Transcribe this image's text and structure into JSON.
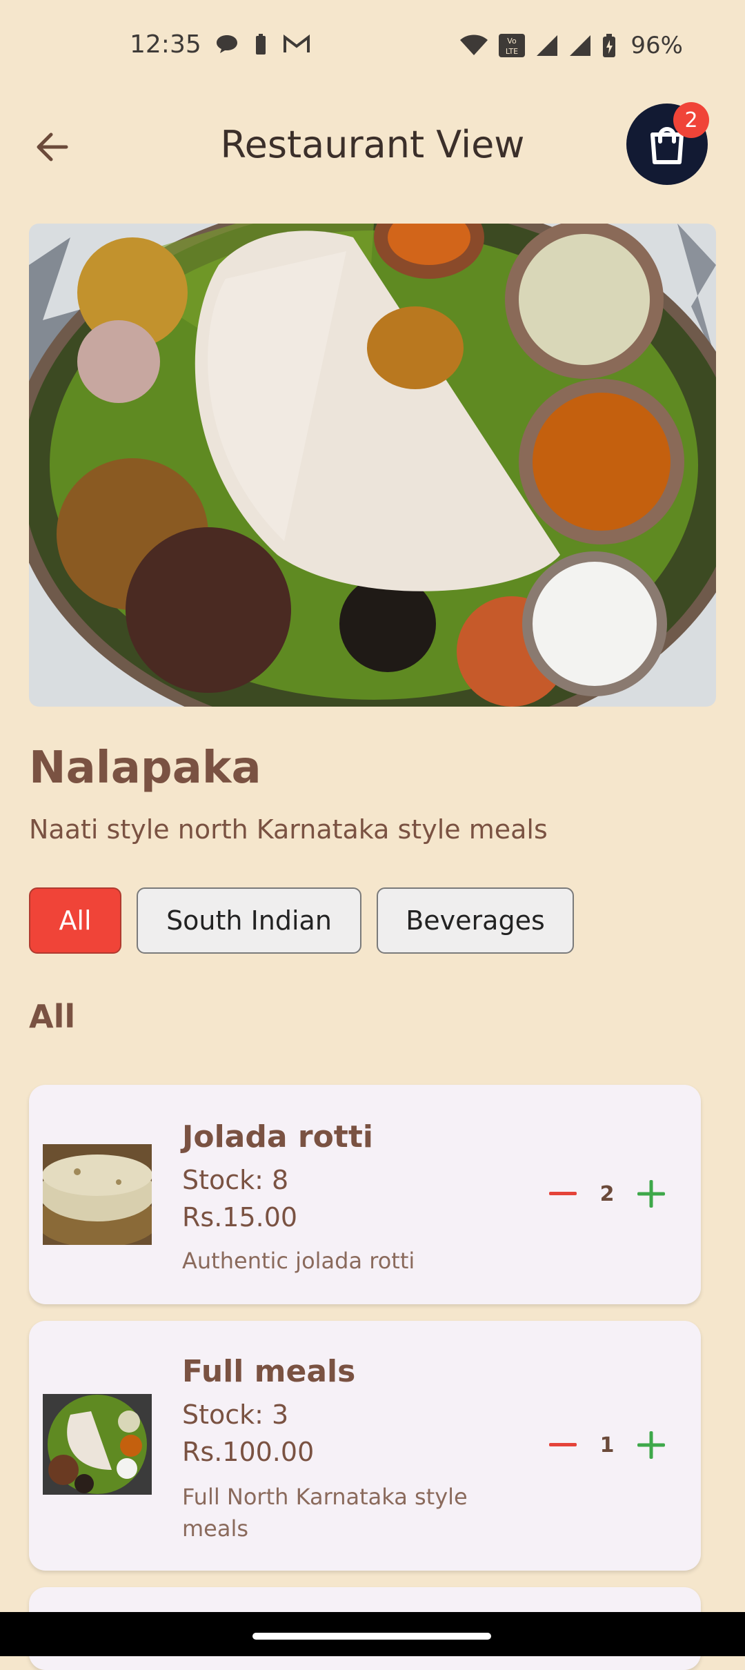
{
  "status_bar": {
    "time": "12:35",
    "battery": "96%"
  },
  "header": {
    "title": "Restaurant View",
    "cart_count": "2"
  },
  "restaurant": {
    "name": "Nalapaka",
    "description": "Naati style north Karnataka style meals"
  },
  "filters": [
    {
      "label": "All",
      "active": true
    },
    {
      "label": "South Indian",
      "active": false
    },
    {
      "label": "Beverages",
      "active": false
    }
  ],
  "section": {
    "title": "All"
  },
  "items": [
    {
      "name": "Jolada rotti",
      "stock": "Stock: 8",
      "price": "Rs.15.00",
      "description": "Authentic jolada rotti",
      "quantity": "2"
    },
    {
      "name": "Full meals",
      "stock": "Stock: 3",
      "price": "Rs.100.00",
      "description": "Full North Karnataka style meals",
      "quantity": "1"
    }
  ],
  "colors": {
    "background": "#f5e6cc",
    "accent": "#f04438",
    "cart": "#121a33",
    "plus": "#3ea84a"
  }
}
